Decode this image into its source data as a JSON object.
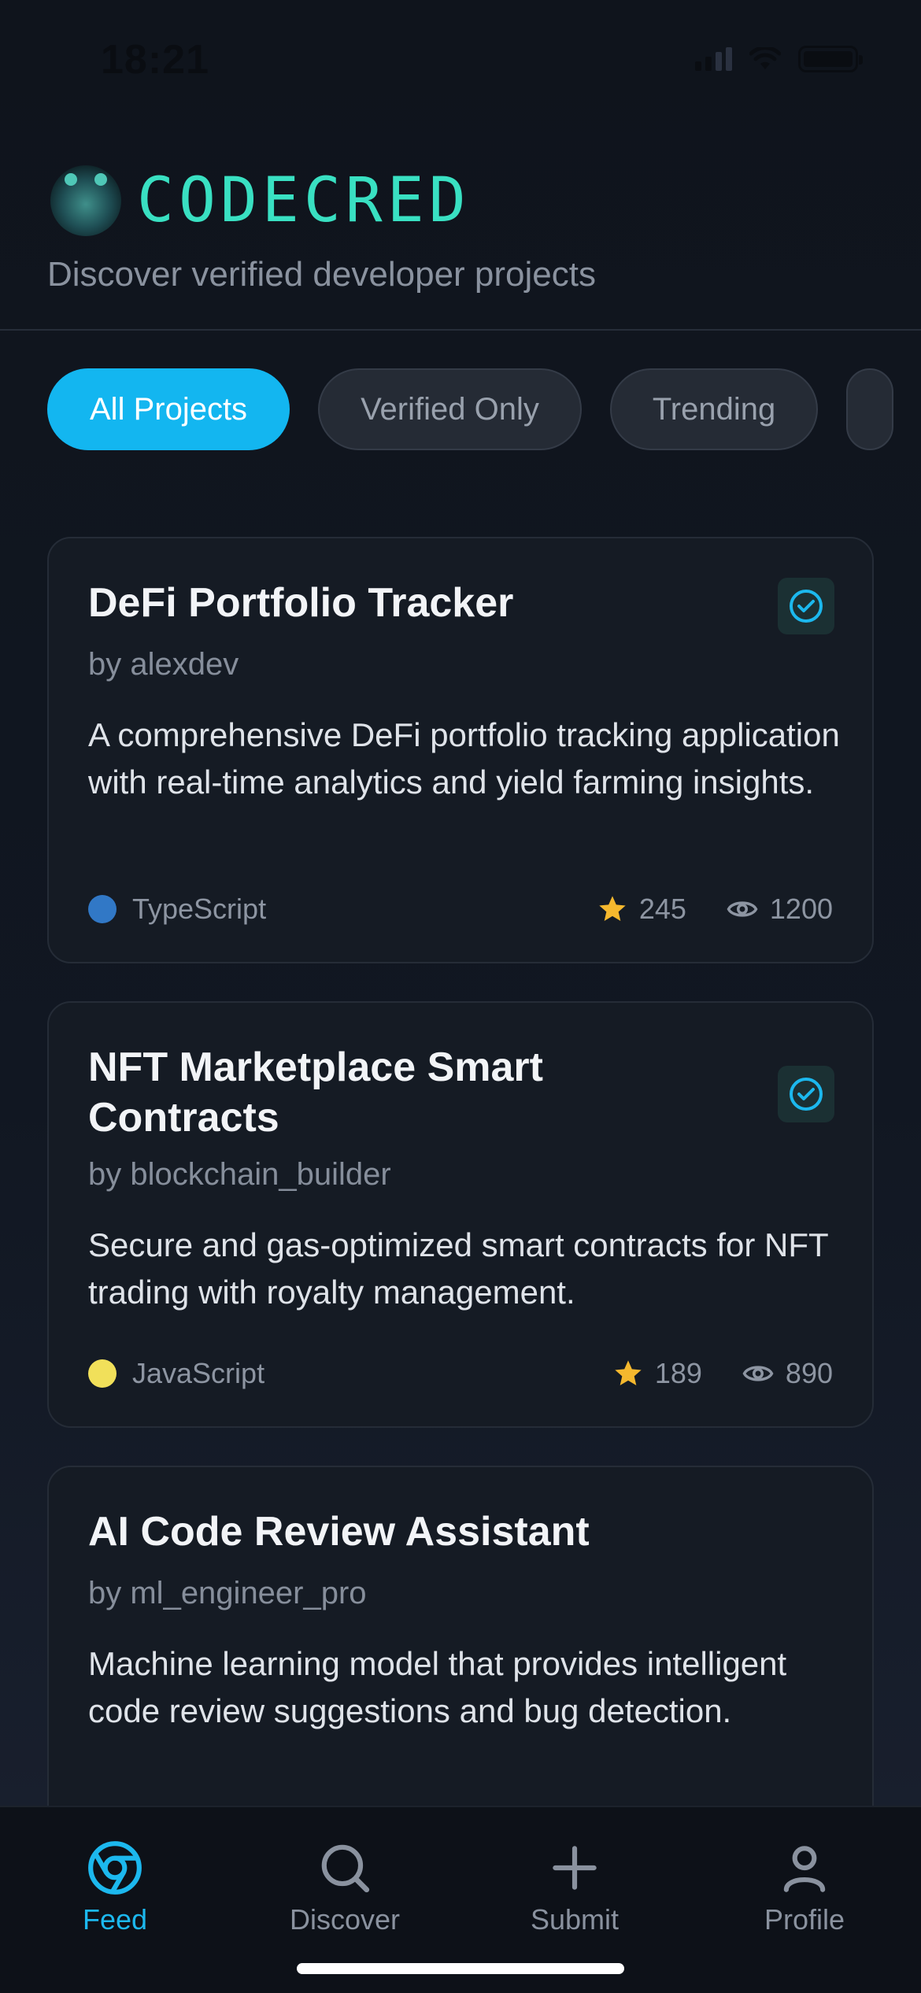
{
  "status_bar": {
    "time": "18:21"
  },
  "header": {
    "brand": "CODECRED",
    "tagline": "Discover verified developer projects"
  },
  "filters": [
    {
      "label": "All Projects",
      "active": true
    },
    {
      "label": "Verified Only",
      "active": false
    },
    {
      "label": "Trending",
      "active": false
    }
  ],
  "projects": [
    {
      "title": "DeFi Portfolio Tracker",
      "author": "by alexdev",
      "description": "A comprehensive DeFi portfolio tracking application with real-time analytics and yield farming insights.",
      "language": "TypeScript",
      "language_color": "#3178c6",
      "stars": "245",
      "views": "1200",
      "verified": true
    },
    {
      "title": "NFT Marketplace Smart Contracts",
      "author": "by blockchain_builder",
      "description": "Secure and gas-optimized smart contracts for NFT trading with royalty management.",
      "language": "JavaScript",
      "language_color": "#f1e05a",
      "stars": "189",
      "views": "890",
      "verified": true
    },
    {
      "title": "AI Code Review Assistant",
      "author": "by ml_engineer_pro",
      "description": "Machine learning model that provides intelligent code review suggestions and bug detection.",
      "verified": false
    }
  ],
  "tabs": [
    {
      "label": "Feed",
      "icon": "chrome-icon",
      "active": true
    },
    {
      "label": "Discover",
      "icon": "search-icon",
      "active": false
    },
    {
      "label": "Submit",
      "icon": "plus-icon",
      "active": false
    },
    {
      "label": "Profile",
      "icon": "user-icon",
      "active": false
    }
  ],
  "colors": {
    "accent": "#13b6f0",
    "brand": "#39e0c2",
    "star": "#f5b82e",
    "background": "#0f141c"
  }
}
